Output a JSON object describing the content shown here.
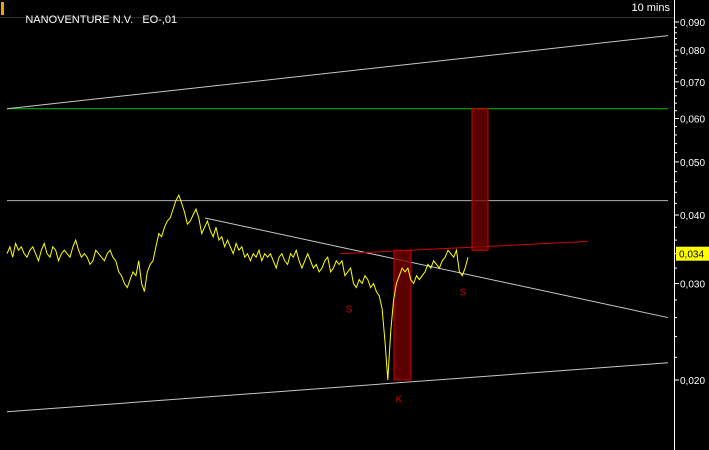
{
  "header": {
    "instrument": "NANOVENTURE N.V.",
    "code": "EO-,01",
    "interval": "10 mins"
  },
  "colors": {
    "background": "#000000",
    "price_line": "#ffff00",
    "trend_lines": "#c8c8c8",
    "green_level": "#00c000",
    "red_marks": "#d00000",
    "box_fill": "#7a0000",
    "last_price_badge": "#ffff00",
    "axis_text": "#ffffff"
  },
  "chart_data": {
    "type": "line",
    "y_scale": "log",
    "ylim": [
      0.0165,
      0.093
    ],
    "y_ticks": [
      "0,090",
      "0,080",
      "0,070",
      "0,060",
      "0,050",
      "0,040",
      "0,030",
      "0,020"
    ],
    "y_tick_values": [
      0.09,
      0.08,
      0.07,
      0.06,
      0.05,
      0.04,
      0.03,
      0.02
    ],
    "last_price": {
      "label": "0,034",
      "value": 0.034
    },
    "series": [
      {
        "values": [
          0.034,
          0.035,
          0.0335,
          0.0355,
          0.0345,
          0.035,
          0.034,
          0.0335,
          0.0345,
          0.035,
          0.034,
          0.033,
          0.0345,
          0.0355,
          0.034,
          0.0335,
          0.035,
          0.0345,
          0.033,
          0.034,
          0.0345,
          0.034,
          0.0335,
          0.035,
          0.036,
          0.0345,
          0.0335,
          0.034,
          0.0335,
          0.0325,
          0.033,
          0.0345,
          0.034,
          0.0335,
          0.033,
          0.034,
          0.0345,
          0.0335,
          0.033,
          0.0315,
          0.031,
          0.03,
          0.0295,
          0.0305,
          0.0315,
          0.031,
          0.033,
          0.03,
          0.029,
          0.0315,
          0.0325,
          0.033,
          0.035,
          0.037,
          0.0365,
          0.038,
          0.039,
          0.0395,
          0.041,
          0.0425,
          0.0435,
          0.042,
          0.0405,
          0.0385,
          0.039,
          0.04,
          0.041,
          0.0395,
          0.037,
          0.038,
          0.039,
          0.0375,
          0.0365,
          0.038,
          0.036,
          0.0365,
          0.035,
          0.036,
          0.035,
          0.034,
          0.0355,
          0.0345,
          0.035,
          0.0335,
          0.034,
          0.033,
          0.034,
          0.0335,
          0.0345,
          0.033,
          0.034,
          0.0335,
          0.034,
          0.033,
          0.032,
          0.0335,
          0.034,
          0.033,
          0.0325,
          0.034,
          0.0335,
          0.0345,
          0.033,
          0.032,
          0.033,
          0.034,
          0.033,
          0.032,
          0.0325,
          0.0315,
          0.032,
          0.033,
          0.0335,
          0.0315,
          0.032,
          0.033,
          0.0325,
          0.033,
          0.031,
          0.0315,
          0.032,
          0.03,
          0.0295,
          0.0305,
          0.03,
          0.031,
          0.0305,
          0.0295,
          0.03,
          0.029,
          0.0285,
          0.027,
          0.0235,
          0.02,
          0.0245,
          0.028,
          0.03,
          0.031,
          0.032,
          0.0315,
          0.032,
          0.0305,
          0.03,
          0.031,
          0.0305,
          0.031,
          0.0315,
          0.0325,
          0.032,
          0.033,
          0.0325,
          0.032,
          0.033,
          0.0335,
          0.0345,
          0.034,
          0.0335,
          0.0345,
          0.0315,
          0.031,
          0.032,
          0.0335
        ]
      }
    ],
    "trendlines": [
      {
        "kind": "upper-channel",
        "from": 0.0625,
        "to": 0.085
      },
      {
        "kind": "lower-channel",
        "from": 0.0175,
        "to": 0.0215
      },
      {
        "kind": "descending-resistance",
        "from": 0.0395,
        "to": 0.026
      },
      {
        "kind": "neckline",
        "from": 0.034,
        "to": 0.0358
      }
    ],
    "horizontal_levels": [
      {
        "kind": "target",
        "value": 0.0625,
        "color": "#00c000"
      },
      {
        "kind": "previous-high",
        "value": 0.0425,
        "color": "#c8c8c8"
      }
    ],
    "projection_boxes": [
      {
        "low": 0.02,
        "high": 0.0345
      },
      {
        "low": 0.0345,
        "high": 0.0625
      }
    ],
    "annotations": [
      {
        "text": "S",
        "value": 0.027
      },
      {
        "text": "K",
        "value": 0.0185
      },
      {
        "text": "S",
        "value": 0.029
      }
    ]
  }
}
